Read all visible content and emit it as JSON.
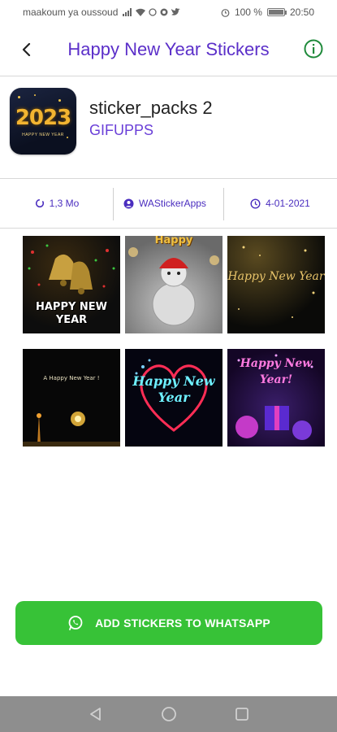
{
  "status_bar": {
    "carrier": "maakoum ya oussoud",
    "icons": [
      "network-4g-icon",
      "signal-icon",
      "wifi-icon",
      "whatsapp-icon",
      "opera-icon",
      "twitter-icon"
    ],
    "alarm_icon": "alarm-icon",
    "battery_percent": "100 %",
    "battery_level": 1.0,
    "time": "20:50"
  },
  "app_bar": {
    "title": "Happy New Year Stickers",
    "back_icon": "arrow-back-icon",
    "info_icon": "info-icon"
  },
  "pack": {
    "icon_year": "2023",
    "icon_caption": "HAPPY NEW YEAR",
    "name": "sticker_packs 2",
    "publisher": "GIFUPPS"
  },
  "details": {
    "size": "1,3 Mo",
    "publisher": "WAStickerApps",
    "date": "4-01-2021",
    "size_icon": "sync-icon",
    "publisher_icon": "account-icon",
    "date_icon": "clock-icon"
  },
  "stickers": [
    {
      "name": "bells-happy-new-year",
      "caption": "HAPPY NEW YEAR"
    },
    {
      "name": "snowman-happy-new-year",
      "caption": "Happy"
    },
    {
      "name": "golden-happy-new-year",
      "caption": "Happy New Year"
    },
    {
      "name": "fireworks-city-happy-new-year",
      "caption": "A Happy New Year !"
    },
    {
      "name": "neon-heart-happy-new-year",
      "caption": "Happy New Year"
    },
    {
      "name": "purple-gifts-happy-new-year",
      "caption": "Happy New Year!"
    }
  ],
  "add_button": {
    "label": "ADD STICKERS TO WHATSAPP",
    "icon": "whatsapp-icon"
  },
  "nav_bar": {
    "back": "nav-back-icon",
    "home": "nav-home-icon",
    "recents": "nav-recents-icon"
  },
  "colors": {
    "accent": "#5b2fc9",
    "button": "#37c237",
    "nav_bar": "#8e8e8e"
  }
}
